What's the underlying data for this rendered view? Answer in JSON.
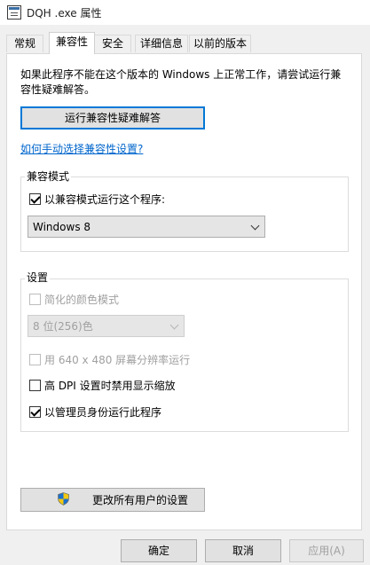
{
  "window": {
    "title": "DQH .exe 属性",
    "icon": "app-window-icon"
  },
  "tabs": [
    {
      "label": "常规",
      "active": false
    },
    {
      "label": "兼容性",
      "active": true
    },
    {
      "label": "安全",
      "active": false
    },
    {
      "label": "详细信息",
      "active": false
    },
    {
      "label": "以前的版本",
      "active": false
    }
  ],
  "compat": {
    "description": "如果此程序不能在这个版本的 Windows 上正常工作，请尝试运行兼容性疑难解答。",
    "troubleshoot_button": "运行兼容性疑难解答",
    "manual_link": "如何手动选择兼容性设置?",
    "mode_group": {
      "title": "兼容模式",
      "checkbox_label": "以兼容模式运行这个程序:",
      "checkbox_checked": true,
      "os_selected": "Windows 8"
    },
    "settings_group": {
      "title": "设置",
      "reduced_color": {
        "label": "简化的颜色模式",
        "checked": false,
        "enabled": false
      },
      "color_depth_selected": "8 位(256)色",
      "low_res": {
        "label": "用 640 x 480 屏幕分辨率运行",
        "checked": false,
        "enabled": false
      },
      "high_dpi": {
        "label": "高 DPI 设置时禁用显示缩放",
        "checked": false,
        "enabled": true
      },
      "run_as_admin": {
        "label": "以管理员身份运行此程序",
        "checked": true,
        "enabled": true
      }
    },
    "all_users_button": "更改所有用户的设置",
    "all_users_icon": "uac-shield-icon"
  },
  "footer": {
    "ok": "确定",
    "cancel": "取消",
    "apply": "应用(A)",
    "apply_enabled": false
  }
}
